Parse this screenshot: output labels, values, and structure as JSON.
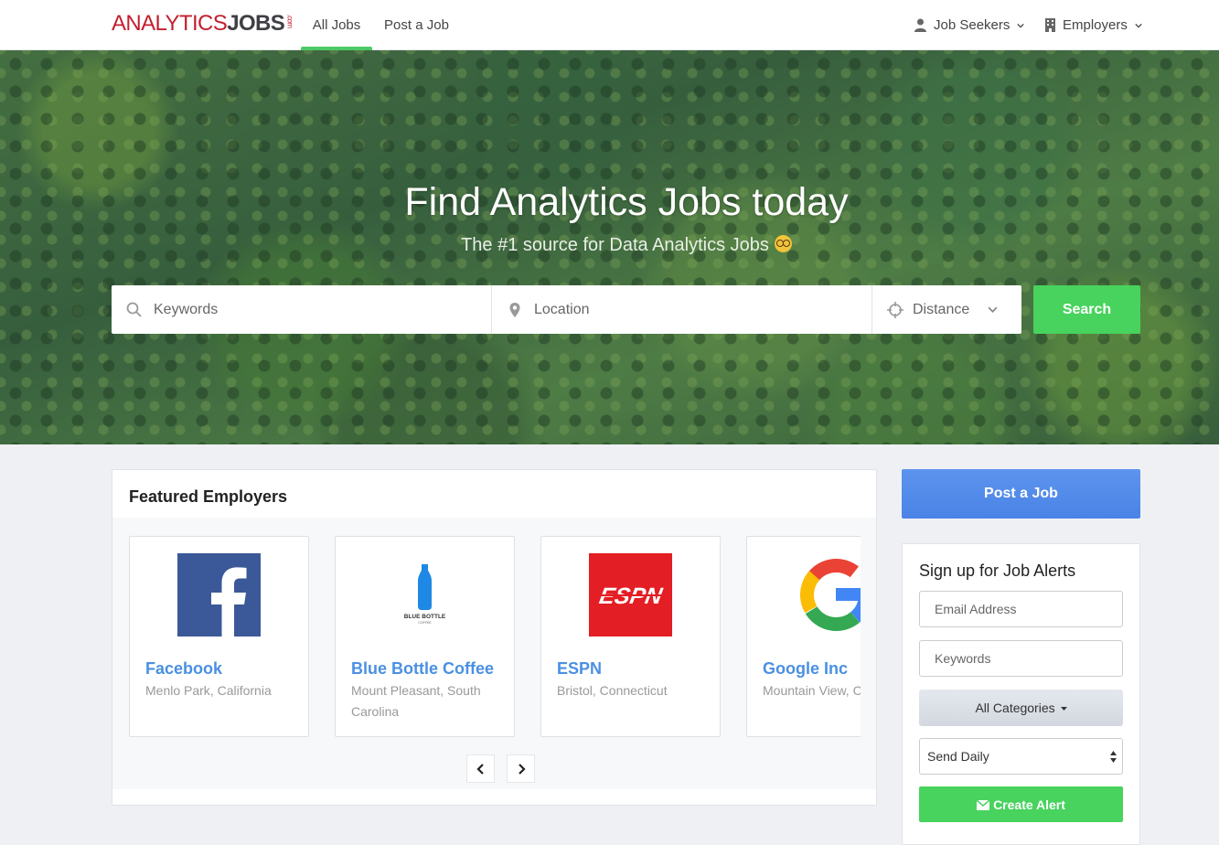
{
  "brand": {
    "logo_part1": "ANALYTICS",
    "logo_part2": "JOBS",
    "logo_suffix": ".com"
  },
  "nav": {
    "tabs": [
      {
        "label": "All Jobs",
        "active": true
      },
      {
        "label": "Post a Job",
        "active": false
      }
    ],
    "job_seekers": "Job Seekers",
    "employers": "Employers"
  },
  "hero": {
    "title": "Find Analytics Jobs today",
    "subtitle": "The #1 source for Data Analytics Jobs"
  },
  "search": {
    "keywords_placeholder": "Keywords",
    "location_placeholder": "Location",
    "distance_label": "Distance",
    "button": "Search"
  },
  "featured": {
    "title": "Featured Employers",
    "employers": [
      {
        "name": "Facebook",
        "location": "Menlo Park, California",
        "logo": "facebook-logo"
      },
      {
        "name": "Blue Bottle Coffee",
        "location": "Mount Pleasant, South Carolina",
        "logo": "blue-bottle-logo",
        "logo_text": "BLUE BOTTLE",
        "logo_subtext": "COFFEE"
      },
      {
        "name": "ESPN",
        "location": "Bristol, Connecticut",
        "logo": "espn-logo",
        "logo_text": "ESPN"
      },
      {
        "name": "Google Inc",
        "location": "Mountain View, California",
        "logo": "google-logo"
      }
    ]
  },
  "sidebar": {
    "post_job": "Post a Job",
    "alerts": {
      "title": "Sign up for Job Alerts",
      "email_placeholder": "Email Address",
      "keywords_placeholder": "Keywords",
      "categories": "All Categories",
      "frequency": "Send Daily",
      "create": "Create Alert"
    }
  },
  "colors": {
    "accent_green": "#47d35d",
    "link_blue": "#4a90e2",
    "brand_red": "#c3202f",
    "post_job_blue": "#5289ea"
  }
}
